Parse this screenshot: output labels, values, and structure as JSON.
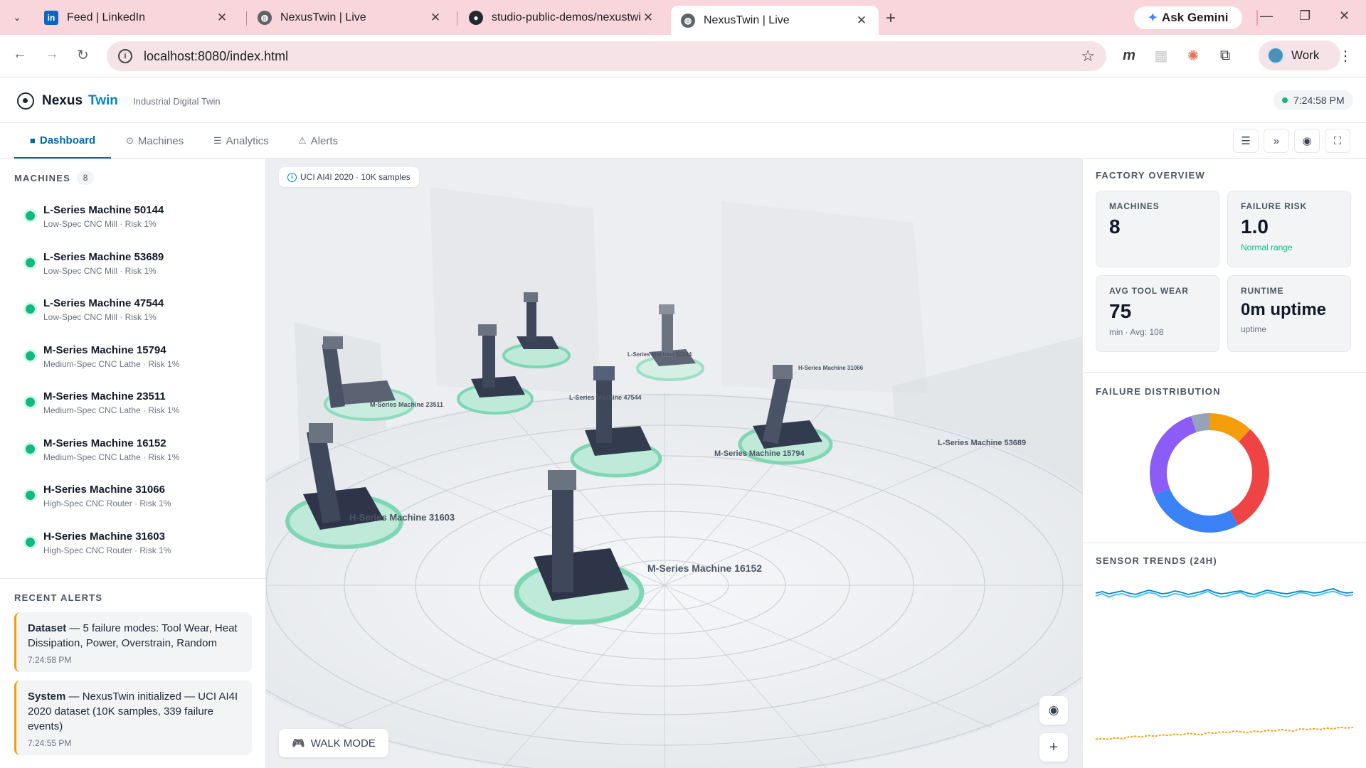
{
  "browser": {
    "tabs": [
      {
        "title": "Feed | LinkedIn",
        "icon": "linkedin-icon"
      },
      {
        "title": "NexusTwin | Live",
        "icon": "globe-icon"
      },
      {
        "title": "studio-public-demos/nexustwin",
        "icon": "github-icon"
      },
      {
        "title": "NexusTwin | Live",
        "icon": "globe-icon",
        "active": true
      }
    ],
    "gemini_label": "Ask Gemini",
    "url": "localhost:8080/index.html",
    "profile_label": "Work"
  },
  "header": {
    "brand_part1": "Nexus",
    "brand_part2": "Twin",
    "subtitle": "Industrial Digital Twin",
    "time": "7:24:58 PM"
  },
  "nav": {
    "tabs": [
      {
        "label": "Dashboard",
        "icon": "■"
      },
      {
        "label": "Machines",
        "icon": "⊙"
      },
      {
        "label": "Analytics",
        "icon": "☰"
      },
      {
        "label": "Alerts",
        "icon": "⚠"
      }
    ],
    "tools": [
      "☰",
      "»",
      "◉",
      "⛶"
    ]
  },
  "sidebar": {
    "machines_title": "MACHINES",
    "machines_count": "8",
    "machines": [
      {
        "name": "L-Series Machine 50144",
        "meta": "Low-Spec CNC Mill · Risk 1%"
      },
      {
        "name": "L-Series Machine 53689",
        "meta": "Low-Spec CNC Mill · Risk 1%"
      },
      {
        "name": "L-Series Machine 47544",
        "meta": "Low-Spec CNC Mill · Risk 1%"
      },
      {
        "name": "M-Series Machine 15794",
        "meta": "Medium-Spec CNC Lathe · Risk 1%"
      },
      {
        "name": "M-Series Machine 23511",
        "meta": "Medium-Spec CNC Lathe · Risk 1%"
      },
      {
        "name": "M-Series Machine 16152",
        "meta": "Medium-Spec CNC Lathe · Risk 1%"
      },
      {
        "name": "H-Series Machine 31066",
        "meta": "High-Spec CNC Router · Risk 1%"
      },
      {
        "name": "H-Series Machine 31603",
        "meta": "High-Spec CNC Router · Risk 1%"
      }
    ],
    "alerts_title": "RECENT ALERTS",
    "alerts": [
      {
        "source": "Dataset",
        "text": " — 5 failure modes: Tool Wear, Heat Dissipation, Power, Overstrain, Random",
        "time": "7:24:58 PM"
      },
      {
        "source": "System",
        "text": " — NexusTwin initialized — UCI AI4I 2020 dataset (10K samples, 339 failure events)",
        "time": "7:24:55 PM"
      }
    ]
  },
  "scene": {
    "dataset_label": "UCI AI4I 2020 · 10K samples",
    "walk_label": "WALK MODE",
    "machine_labels": [
      "L-Series Machine 50144",
      "H-Series Machine 31066",
      "L-Series Machine 47544",
      "M-Series Machine 23511",
      "M-Series Machine 15794",
      "L-Series Machine 53689",
      "H-Series Machine 31603",
      "M-Series Machine 16152"
    ]
  },
  "overview": {
    "title": "FACTORY OVERVIEW",
    "cards": [
      {
        "label": "MACHINES",
        "value": "8",
        "sub": ""
      },
      {
        "label": "FAILURE RISK",
        "value": "1.0",
        "sub": "Normal range"
      },
      {
        "label": "AVG TOOL WEAR",
        "value": "75",
        "sub": "min · Avg: 108"
      },
      {
        "label": "RUNTIME",
        "value": "0m uptime",
        "sub": "uptime"
      }
    ]
  },
  "failure_distribution": {
    "title": "FAILURE DISTRIBUTION",
    "segments": [
      {
        "value": 12,
        "color": "#f59e0b"
      },
      {
        "value": 30,
        "color": "#ef4444"
      },
      {
        "value": 27,
        "color": "#3b82f6"
      },
      {
        "value": 26,
        "color": "#8b5cf6"
      },
      {
        "value": 5,
        "color": "#94a3b8"
      }
    ]
  },
  "sensor_trends": {
    "title": "SENSOR TRENDS (24H)",
    "series": [
      {
        "color": "#0284c7",
        "values": [
          50,
          52,
          49,
          51,
          53,
          50,
          48,
          51,
          54,
          52,
          49,
          50,
          53,
          51,
          48,
          50,
          52,
          55,
          51,
          49,
          50,
          52,
          53,
          50,
          48,
          51,
          54,
          52,
          50,
          49,
          51,
          53,
          52,
          50,
          51,
          54,
          56,
          52,
          50,
          51
        ]
      },
      {
        "color": "#38bdf8",
        "values": [
          48,
          50,
          47,
          49,
          50,
          48,
          47,
          49,
          51,
          50,
          47,
          48,
          50,
          49,
          47,
          48,
          50,
          52,
          49,
          47,
          48,
          50,
          51,
          48,
          47,
          49,
          51,
          50,
          48,
          47,
          49,
          51,
          50,
          48,
          49,
          51,
          52,
          50,
          48,
          49
        ]
      },
      {
        "color": "#f59e0b",
        "values": [
          8,
          9,
          8,
          10,
          9,
          11,
          12,
          11,
          13,
          12,
          14,
          13,
          15,
          14,
          16,
          15,
          14,
          17,
          16,
          18,
          17,
          19,
          18,
          17,
          19,
          18,
          20,
          19,
          21,
          20,
          19,
          22,
          21,
          22,
          21,
          23,
          22,
          24,
          23,
          24
        ]
      }
    ]
  }
}
